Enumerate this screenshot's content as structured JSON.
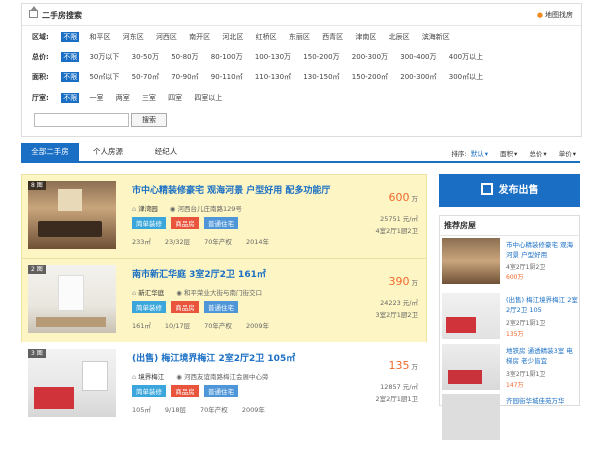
{
  "header": {
    "title": "二手房搜索",
    "map_link": "地图找房"
  },
  "filters": [
    {
      "label": "区域:",
      "options": [
        "不限",
        "和平区",
        "河东区",
        "河西区",
        "南开区",
        "河北区",
        "红桥区",
        "东丽区",
        "西青区",
        "津南区",
        "北辰区",
        "滨海新区"
      ]
    },
    {
      "label": "总价:",
      "options": [
        "不限",
        "30万以下",
        "30-50万",
        "50-80万",
        "80-100万",
        "100-130万",
        "150-200万",
        "200-300万",
        "300-400万",
        "400万以上"
      ]
    },
    {
      "label": "面积:",
      "options": [
        "不限",
        "50㎡以下",
        "50-70㎡",
        "70-90㎡",
        "90-110㎡",
        "110-130㎡",
        "130-150㎡",
        "150-200㎡",
        "200-300㎡",
        "300㎡以上"
      ]
    },
    {
      "label": "厅室:",
      "options": [
        "不限",
        "一室",
        "两室",
        "三室",
        "四室",
        "四室以上"
      ]
    }
  ],
  "search": {
    "button": "搜索",
    "placeholder": ""
  },
  "tabs": [
    "全部二手房",
    "个人房源",
    "经纪人"
  ],
  "sort": {
    "label": "排序:",
    "options": [
      "默认",
      "面积",
      "总价",
      "单价"
    ]
  },
  "listings": [
    {
      "badge": "8 图",
      "title": "市中心精装修豪宅 观海河景 户型好用 配多功能厅",
      "community": "津湾园",
      "address": "河西台儿庄南路129号",
      "tags": [
        "简单装修",
        "商品房",
        "普通住宅"
      ],
      "meta": [
        "233㎡",
        "23/32层",
        "70年产权",
        "2014年"
      ],
      "price": "600",
      "price_unit": "万",
      "unit_price": "25751 元/㎡",
      "rooms": "4室2厅1厨2卫"
    },
    {
      "badge": "2 图",
      "title": "南市新汇华庭 3室2厅2卫 161㎡",
      "community": "新汇华庭",
      "address": "和平荣业大街与南门街交口",
      "tags": [
        "简单装修",
        "商品房",
        "普通住宅"
      ],
      "meta": [
        "161㎡",
        "10/17层",
        "70年产权",
        "2009年"
      ],
      "price": "390",
      "price_unit": "万",
      "unit_price": "24223 元/㎡",
      "rooms": "3室2厅1厨2卫"
    },
    {
      "badge": "3 图",
      "title": "(出售) 梅江境界梅江 2室2厅2卫 105㎡",
      "community": "境界梅江",
      "address": "河西友谊南路梅江会展中心旁",
      "tags": [
        "简单装修",
        "商品房",
        "普通住宅"
      ],
      "meta": [
        "105㎡",
        "9/18层",
        "70年产权",
        "2009年"
      ],
      "price": "135",
      "price_unit": "万",
      "unit_price": "12857 元/㎡",
      "rooms": "2室2厅1厨1卫"
    }
  ],
  "sidebar": {
    "publish": "发布出售",
    "rec_title": "推荐房屋",
    "items": [
      {
        "title": "市中心精装修豪宅 观海河景 户型好用",
        "rooms": "4室2厅1厨2卫",
        "price": "600万"
      },
      {
        "title": "(出售) 梅江境界梅江 2室2厅2卫 105",
        "rooms": "2室2厅1厨1卫",
        "price": "135万"
      },
      {
        "title": "地铁房 通透精装3室 电梯房 老少皆宜",
        "rooms": "3室2厅1厨1卫",
        "price": "147万"
      },
      {
        "title": "齐园街华城佳苑万华"
      }
    ]
  },
  "colors": {
    "accent": "#1a6fc4",
    "price": "#f0682c",
    "highlight_bg": "#fdf6c4"
  }
}
